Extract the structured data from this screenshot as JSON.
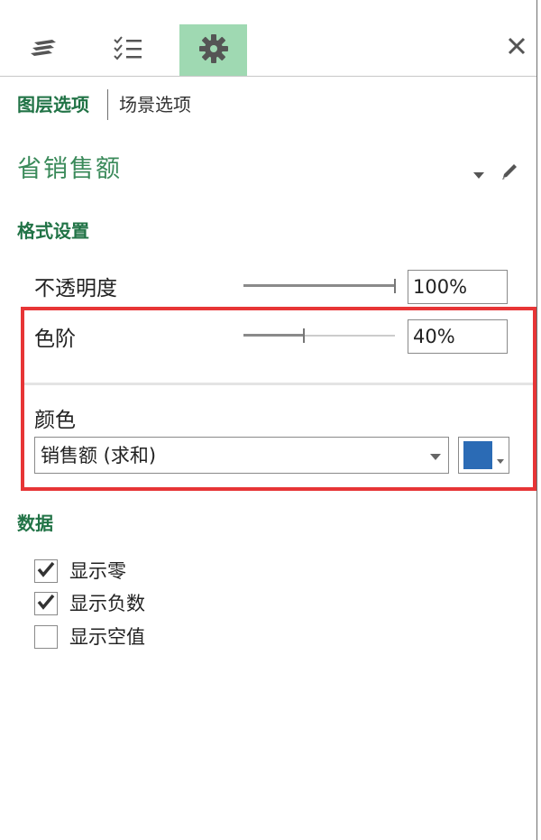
{
  "toolbar": {
    "tabs": [
      {
        "icon": "layers-icon",
        "active": false
      },
      {
        "icon": "checklist-icon",
        "active": false
      },
      {
        "icon": "gear-icon",
        "active": true
      }
    ],
    "close_icon": "close-icon",
    "accent_color": "#9fd9b2"
  },
  "subtabs": {
    "layer_options": "图层选项",
    "scene_options": "场景选项"
  },
  "layer": {
    "name": "省销售额",
    "name_color": "#3a8a5a"
  },
  "format_section": {
    "title": "格式设置",
    "opacity": {
      "label": "不透明度",
      "value": "100%",
      "fraction": 1.0
    },
    "color_scale": {
      "label": "色阶",
      "value": "40%",
      "fraction": 0.4
    },
    "color": {
      "label": "颜色",
      "selected": "销售额 (求和)",
      "swatch": "#2b6bb5"
    },
    "highlight_color": "#e73536"
  },
  "data_section": {
    "title": "数据",
    "options": [
      {
        "label": "显示零",
        "checked": true
      },
      {
        "label": "显示负数",
        "checked": true
      },
      {
        "label": "显示空值",
        "checked": false
      }
    ]
  },
  "section_color": "#217346"
}
